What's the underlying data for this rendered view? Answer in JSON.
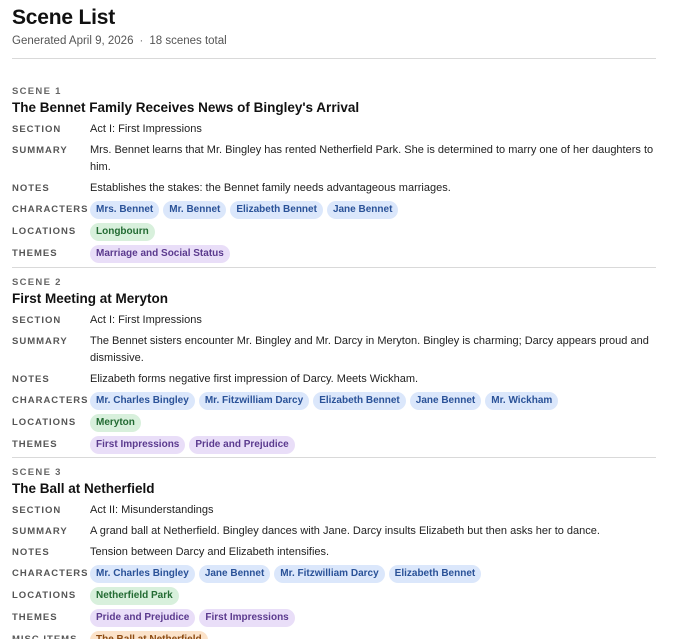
{
  "header": {
    "title": "Scene List",
    "generated": "Generated April 9, 2026",
    "separator": "·",
    "total": "18 scenes total"
  },
  "field_labels": {
    "section": "SECTION",
    "summary": "SUMMARY",
    "notes": "NOTES",
    "characters": "CHARACTERS",
    "locations": "LOCATIONS",
    "themes": "THEMES",
    "misc": "MISC ITEMS"
  },
  "scenes": [
    {
      "label": "SCENE 1",
      "title": "The Bennet Family Receives News of Bingley's Arrival",
      "section": "Act I: First Impressions",
      "summary": "Mrs. Bennet learns that Mr. Bingley has rented Netherfield Park. She is determined to marry one of her daughters to him.",
      "notes": "Establishes the stakes: the Bennet family needs advantageous marriages.",
      "characters": [
        "Mrs. Bennet",
        "Mr. Bennet",
        "Elizabeth Bennet",
        "Jane Bennet"
      ],
      "locations": [
        "Longbourn"
      ],
      "themes": [
        "Marriage and Social Status"
      ]
    },
    {
      "label": "SCENE 2",
      "title": "First Meeting at Meryton",
      "section": "Act I: First Impressions",
      "summary": "The Bennet sisters encounter Mr. Bingley and Mr. Darcy in Meryton. Bingley is charming; Darcy appears proud and dismissive.",
      "notes": "Elizabeth forms negative first impression of Darcy. Meets Wickham.",
      "characters": [
        "Mr. Charles Bingley",
        "Mr. Fitzwilliam Darcy",
        "Elizabeth Bennet",
        "Jane Bennet",
        "Mr. Wickham"
      ],
      "locations": [
        "Meryton"
      ],
      "themes": [
        "First Impressions",
        "Pride and Prejudice"
      ]
    },
    {
      "label": "SCENE 3",
      "title": "The Ball at Netherfield",
      "section": "Act II: Misunderstandings",
      "summary": "A grand ball at Netherfield. Bingley dances with Jane. Darcy insults Elizabeth but then asks her to dance.",
      "notes": "Tension between Darcy and Elizabeth intensifies.",
      "characters": [
        "Mr. Charles Bingley",
        "Jane Bennet",
        "Mr. Fitzwilliam Darcy",
        "Elizabeth Bennet"
      ],
      "locations": [
        "Netherfield Park"
      ],
      "themes": [
        "Pride and Prejudice",
        "First Impressions"
      ],
      "misc": [
        "The Ball at Netherfield"
      ]
    }
  ]
}
